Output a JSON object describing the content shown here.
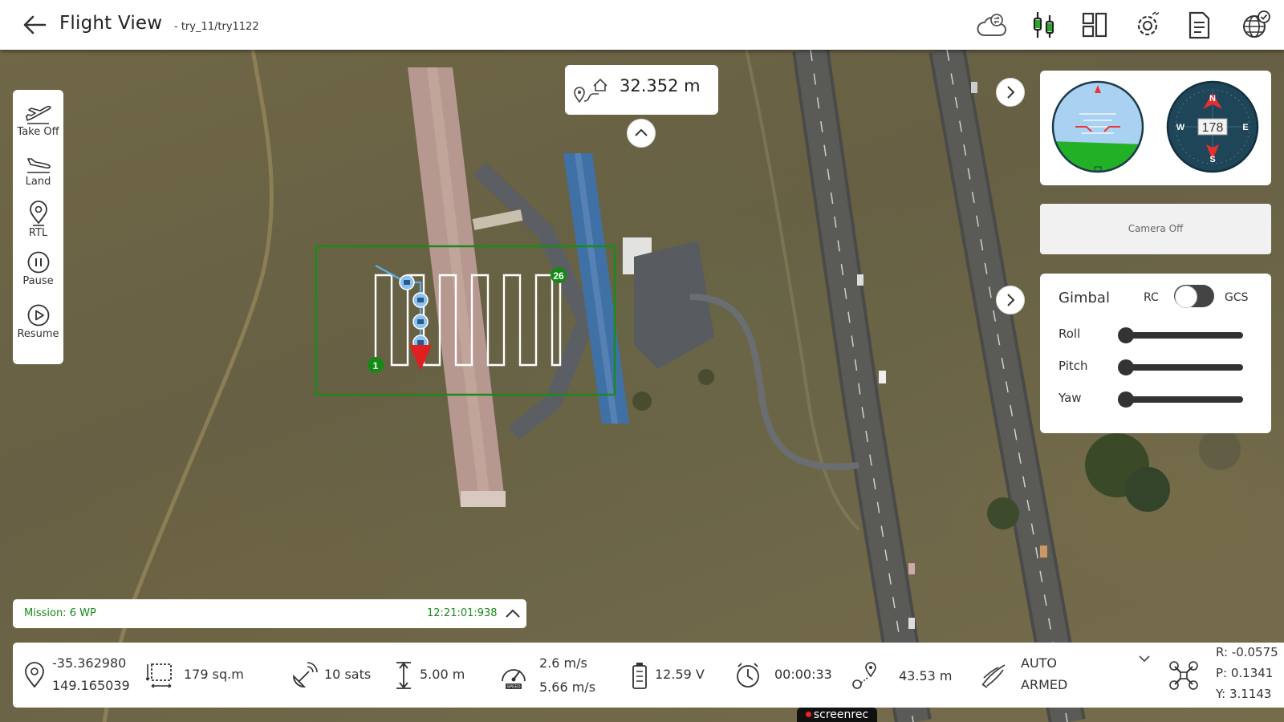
{
  "header": {
    "title": "Flight View",
    "subtitle": "- try_11/try1122",
    "icons": [
      "cloud-sync-icon",
      "drone-connect-icon",
      "layout-icon",
      "settings-icon",
      "log-icon",
      "globe-check-icon"
    ]
  },
  "actions": [
    {
      "label": "Take Off",
      "icon": "takeoff-icon"
    },
    {
      "label": "Land",
      "icon": "land-icon"
    },
    {
      "label": "RTL",
      "icon": "location-pin-icon"
    },
    {
      "label": "Pause",
      "icon": "pause-icon"
    },
    {
      "label": "Resume",
      "icon": "play-icon"
    }
  ],
  "distance": {
    "value": "32.352 m",
    "icon": "home-distance-icon"
  },
  "map": {
    "waypoint_start": "1",
    "waypoint_end": "26",
    "survey_color": "#1a8a1a",
    "heading_marker_color": "#e02020"
  },
  "instruments": {
    "heading_value": "178",
    "compass_labels": {
      "n": "N",
      "s": "S",
      "e": "E",
      "w": "W"
    }
  },
  "camera": {
    "status": "Camera Off"
  },
  "gimbal": {
    "title": "Gimbal",
    "rc_label": "RC",
    "gcs_label": "GCS",
    "axes": [
      {
        "label": "Roll",
        "value": 0
      },
      {
        "label": "Pitch",
        "value": 0
      },
      {
        "label": "Yaw",
        "value": 0
      }
    ]
  },
  "mission": {
    "label": "Mission: 6 WP",
    "time": "12:21:01:938"
  },
  "telemetry": {
    "lat": "-35.362980",
    "lon": "149.165039",
    "area": "179 sq.m",
    "sats": "10 sats",
    "altitude": "5.00 m",
    "speed_ground": "2.6 m/s",
    "speed_air": "5.66 m/s",
    "speedo_label": "SPEED",
    "battery": "12.59 V",
    "flight_time": "00:00:33",
    "home_distance": "43.53 m",
    "mode": "AUTO",
    "arm_state": "ARMED",
    "roll": "R: -0.0575",
    "pitch": "P: 0.1341",
    "yaw": "Y: 3.1143"
  },
  "recorder": {
    "label": "screenrec"
  }
}
